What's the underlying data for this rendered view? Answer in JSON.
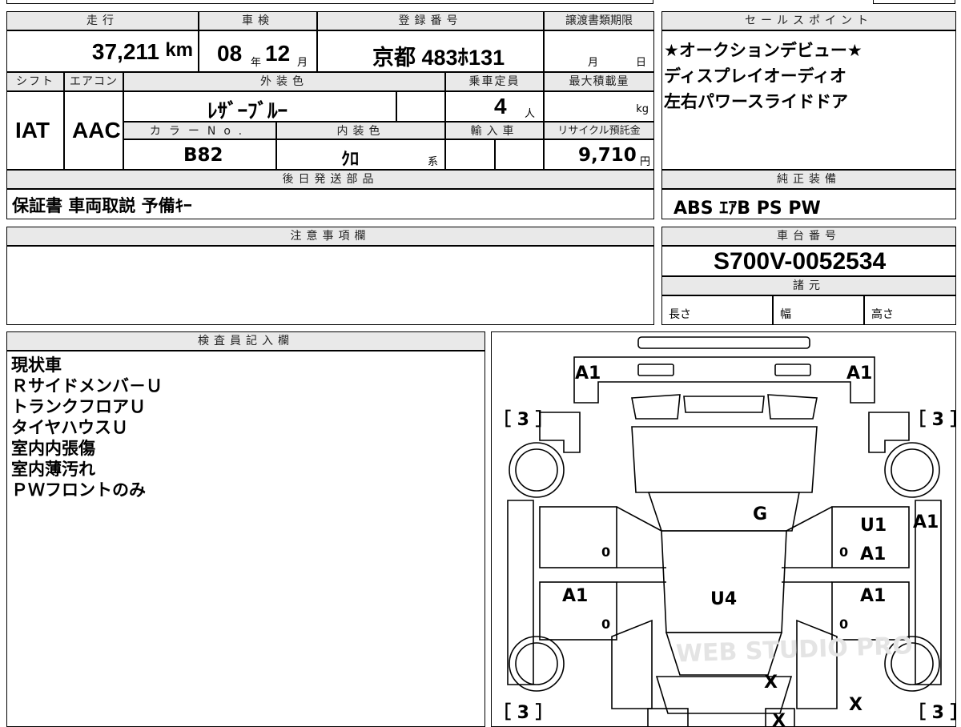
{
  "mileage": {
    "header": "走行",
    "value": "37,211",
    "unit": "km"
  },
  "inspection": {
    "header": "車検",
    "year": "08",
    "year_unit": "年",
    "month": "12",
    "month_unit": "月"
  },
  "registration": {
    "header": "登録番号",
    "value": "京都 483ﾎ131"
  },
  "transfer_deadline": {
    "header": "譲渡書類期限",
    "month_unit": "月",
    "day_unit": "日"
  },
  "shift": {
    "header": "シフト",
    "value": "IAT"
  },
  "aircon": {
    "header": "エアコン",
    "value": "AAC"
  },
  "exterior_color": {
    "header": "外装色",
    "value": "ﾚｻﾞｰﾌﾞﾙｰ"
  },
  "capacity": {
    "header": "乗車定員",
    "value": "4",
    "unit": "人"
  },
  "max_load": {
    "header": "最大積載量",
    "unit": "kg"
  },
  "color_no": {
    "header": "カラーNo.",
    "value": "B82"
  },
  "interior_color": {
    "header": "内装色",
    "value": "ｸﾛ",
    "suffix": "系"
  },
  "import": {
    "header": "輸入車"
  },
  "recycle_fee": {
    "header": "リサイクル預託金",
    "value": "9,710",
    "unit": "円"
  },
  "later_parts": {
    "header": "後日発送部品",
    "value": "保証書 車両取説 予備ｷｰ"
  },
  "sales_points": {
    "header": "セールスポイント",
    "lines": [
      "★オークションデビュー★",
      "ディスプレイオーディオ",
      "左右パワースライドドア"
    ]
  },
  "equipment": {
    "header": "純正装備",
    "value": "ABS ｴｱB PS PW"
  },
  "notes": {
    "header": "注意事項欄"
  },
  "chassis": {
    "header": "車台番号",
    "value": "S700V-0052534"
  },
  "specs": {
    "header": "諸元",
    "length": "長さ",
    "width": "幅",
    "height": "高さ"
  },
  "inspector": {
    "header": "検査員記入欄",
    "lines": [
      "現状車",
      "Ｒサイドメンバ－Ｕ",
      "トランクフロアＵ",
      "タイヤハウスＵ",
      "室内内張傷",
      "室内薄汚れ",
      "ＰＷフロントのみ"
    ]
  },
  "diagram": {
    "marks": {
      "front_left": "A1",
      "front_right": "A1",
      "tire_fl": "［ 3 ］",
      "tire_fr": "［ 3 ］",
      "tire_rl": "［ 3 ］",
      "tire_rr": "［ 3 ］",
      "windshield": "G",
      "roof": "U4",
      "right_front_door_1": "U1",
      "right_front_door_2": "A1",
      "right_fender": "A1",
      "left_rear_door": "A1",
      "right_rear_door": "A1",
      "rear_center": "X",
      "rear_right": "X",
      "rear_bumper": "X",
      "door_zero_1": "0",
      "door_zero_2": "0",
      "door_zero_3": "0",
      "door_zero_4": "0"
    },
    "watermark": "WEB STUDIO PRO"
  }
}
